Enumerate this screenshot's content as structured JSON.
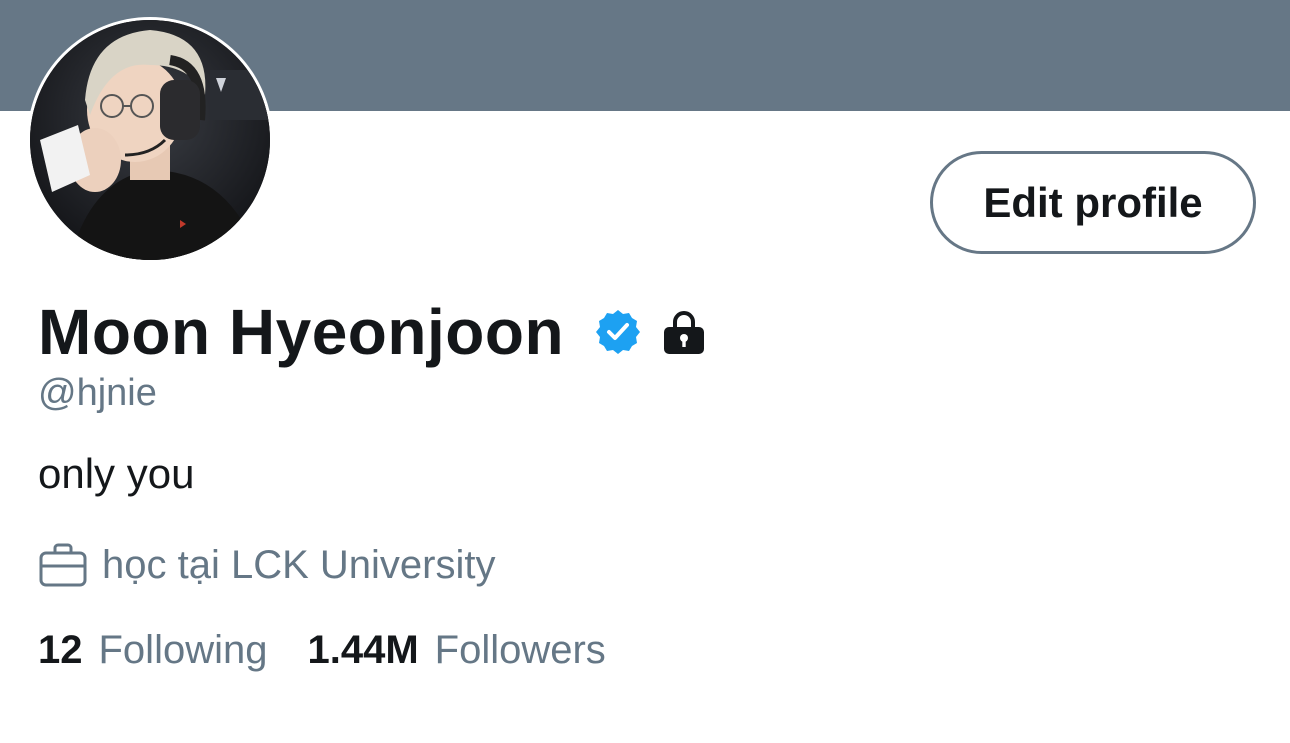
{
  "profile": {
    "display_name": "Moon Hyeonjoon",
    "handle": "@hjnie",
    "bio": "only you",
    "workplace": "học tại LCK University",
    "verified": true,
    "protected": true,
    "banner_color": "#667786"
  },
  "actions": {
    "edit_profile_label": "Edit profile"
  },
  "stats": {
    "following_count": "12",
    "following_label": "Following",
    "followers_count": "1.44M",
    "followers_label": "Followers"
  },
  "icons": {
    "verified": "verified-badge-icon",
    "lock": "lock-icon",
    "work": "briefcase-icon"
  },
  "colors": {
    "verified_blue": "#1da1f2",
    "secondary_text": "#657786",
    "primary_text": "#14171a"
  }
}
